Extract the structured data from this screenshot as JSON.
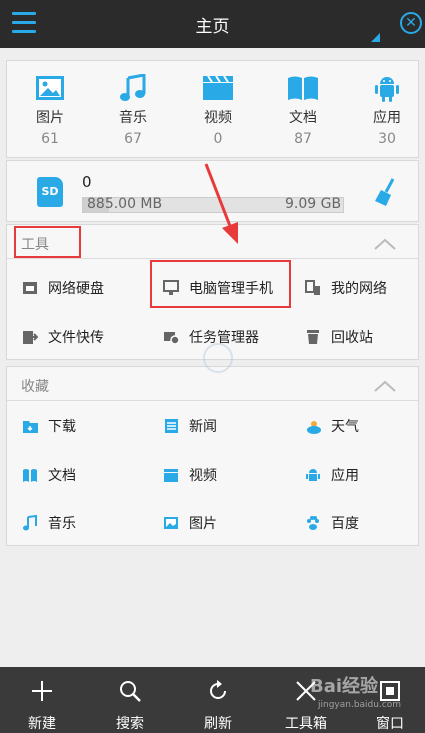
{
  "header": {
    "title": "主页"
  },
  "categories": [
    {
      "label": "图片",
      "count": "61",
      "icon": "image-icon"
    },
    {
      "label": "音乐",
      "count": "67",
      "icon": "music-icon"
    },
    {
      "label": "视频",
      "count": "0",
      "icon": "video-icon"
    },
    {
      "label": "文档",
      "count": "87",
      "icon": "book-icon"
    },
    {
      "label": "应用",
      "count": "30",
      "icon": "android-icon"
    }
  ],
  "storage": {
    "badge": "SD",
    "name": "0",
    "used": "885.00 MB",
    "total": "9.09 GB",
    "fill": 0.1
  },
  "tools": {
    "title": "工具",
    "items": [
      "网络硬盘",
      "电脑管理手机",
      "我的网络",
      "文件快传",
      "任务管理器",
      "回收站"
    ]
  },
  "favorites": {
    "title": "收藏",
    "items": [
      "下载",
      "新闻",
      "天气",
      "文档",
      "视频",
      "应用",
      "音乐",
      "图片",
      "百度"
    ]
  },
  "bottom_bar": [
    "新建",
    "搜索",
    "刷新",
    "工具箱",
    "窗口"
  ],
  "watermark": {
    "brand": "Bai经验",
    "url": "jingyan.baidu.com"
  },
  "colors": {
    "accent": "#29a9e6",
    "highlight": "#e83a3a",
    "topbar": "#2b2b2b",
    "bottombar": "#3a3a3a"
  }
}
